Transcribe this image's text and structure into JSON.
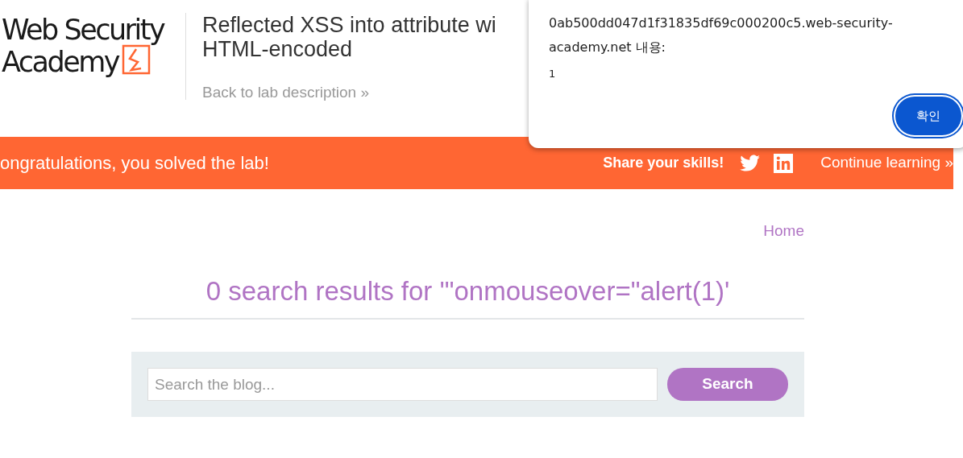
{
  "header": {
    "logo": {
      "line_1": "Web Security",
      "line_2": "Academy"
    },
    "title_lines": [
      "Reflected XSS into attribute wi",
      "HTML-encoded"
    ],
    "back_link": {
      "label": "Back to lab description",
      "icon": "»"
    }
  },
  "banner": {
    "message": "ongratulations, you solved the lab!",
    "share_label": "Share your skills!",
    "continue_link": {
      "label": "Continue learning",
      "icon": "»"
    }
  },
  "nav": {
    "links": [
      "Home"
    ]
  },
  "results": {
    "heading": "0 search results for '\"onmouseover=\"alert(1)'"
  },
  "search": {
    "placeholder": "Search the blog...",
    "button": "Search"
  },
  "dialog": {
    "origin": "0ab500dd047d1f31835df69c000200c5.web-security-academy.net 내용:",
    "message": "1",
    "button": {
      "label": "확인",
      "focused": true
    }
  }
}
